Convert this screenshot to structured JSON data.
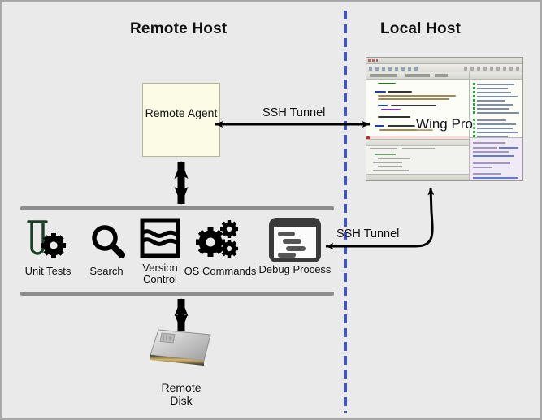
{
  "diagram": {
    "title_remote": "Remote Host",
    "title_local": "Local Host",
    "divider": "vertical-dashed-blue-line",
    "divider_color": "#4053c8",
    "background_color": "#eaeaea",
    "frame_color": "#a8a8a8"
  },
  "remote_agent": {
    "label": "Remote\nAgent",
    "fill_color": "#fbfbe6",
    "border_color": "#b4b49a"
  },
  "connections": {
    "ssh_tunnel_top": "SSH Tunnel",
    "ssh_tunnel_bottom": "SSH Tunnel"
  },
  "tools": [
    {
      "id": "unit-tests",
      "label": "Unit Tests",
      "icon": "test-tube-gear-icon",
      "color": "#1c3d27"
    },
    {
      "id": "search",
      "label": "Search",
      "icon": "magnifier-icon",
      "color": "#000000"
    },
    {
      "id": "version",
      "label": "Version\nControl",
      "icon": "version-control-icon",
      "color": "#000000"
    },
    {
      "id": "os-commands",
      "label": "OS Commands",
      "icon": "gears-icon",
      "color": "#000000"
    },
    {
      "id": "debug",
      "label": "Debug Process",
      "icon": "terminal-window-icon",
      "color": "#3a3a3a"
    }
  ],
  "remote_disk": {
    "label": "Remote\nDisk",
    "icon": "external-hard-drive-icon"
  },
  "wing_pro": {
    "label": "Wing Pro",
    "window": "ide-screenshot"
  }
}
